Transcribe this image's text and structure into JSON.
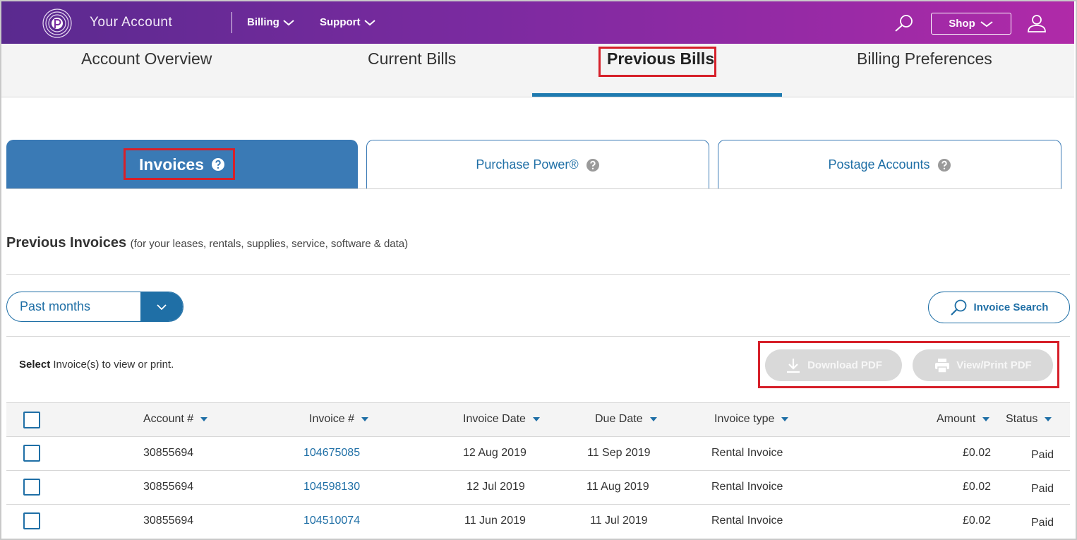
{
  "header": {
    "app_title": "Your Account",
    "menus": [
      {
        "label": "Billing",
        "icon": "chevron-down-icon"
      },
      {
        "label": "Support",
        "icon": "chevron-down-icon"
      }
    ],
    "search_icon": "search-icon",
    "shop_label": "Shop",
    "user_icon": "user-icon",
    "gradient_start": "#5a2a8f",
    "gradient_end": "#b02aa8"
  },
  "main_tabs": [
    {
      "label": "Account Overview",
      "active": false
    },
    {
      "label": "Current Bills",
      "active": false
    },
    {
      "label": "Previous Bills",
      "active": true
    },
    {
      "label": "Billing Preferences",
      "active": false
    }
  ],
  "sub_tabs": [
    {
      "label": "Invoices",
      "active": true,
      "icon": "help-icon"
    },
    {
      "label": "Purchase Power®",
      "active": false,
      "icon": "help-icon"
    },
    {
      "label": "Postage Accounts",
      "active": false,
      "icon": "help-icon"
    }
  ],
  "section": {
    "title": "Previous Invoices",
    "subtitle": "(for your leases, rentals, supplies, service, software & data)"
  },
  "filter": {
    "selected": "Past months"
  },
  "invoice_search_label": "Invoice Search",
  "select_note": {
    "bold": "Select",
    "rest": "Invoice(s) to view or print."
  },
  "pdf_buttons": {
    "download": "Download PDF",
    "view_print": "View/Print PDF"
  },
  "table": {
    "columns": [
      "Account #",
      "Invoice #",
      "Invoice Date",
      "Due Date",
      "Invoice type",
      "Amount",
      "Status"
    ],
    "rows": [
      {
        "account": "30855694",
        "invoice": "104675085",
        "invoice_date": "12 Aug 2019",
        "due_date": "11 Sep 2019",
        "type": "Rental Invoice",
        "amount": "£0.02",
        "status": "Paid"
      },
      {
        "account": "30855694",
        "invoice": "104598130",
        "invoice_date": "12 Jul 2019",
        "due_date": "11 Aug 2019",
        "type": "Rental Invoice",
        "amount": "£0.02",
        "status": "Paid"
      },
      {
        "account": "30855694",
        "invoice": "104510074",
        "invoice_date": "11 Jun 2019",
        "due_date": "11 Jul 2019",
        "type": "Rental Invoice",
        "amount": "£0.02",
        "status": "Paid"
      }
    ]
  },
  "colors": {
    "primary_blue": "#1f6fa6",
    "active_tab_blue": "#3a7ab5",
    "highlight_red": "#d6202a",
    "disabled_gray": "#d9d9d9"
  }
}
